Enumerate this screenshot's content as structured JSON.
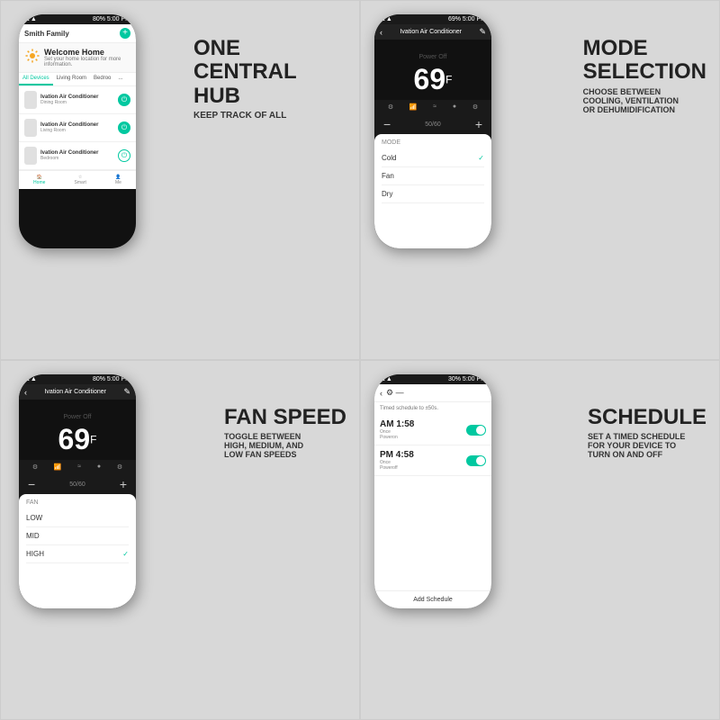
{
  "cells": {
    "cell1": {
      "feature_main": "ONE\nCENTRAL HUB",
      "feature_sub": "KEEP TRACK OF ALL",
      "app": {
        "family": "Smith Family",
        "status_bar": "80%  5:00 PM",
        "welcome_title": "Welcome Home",
        "welcome_sub": "Set your home location for more information.",
        "tabs": [
          "All Devices",
          "Living Room",
          "Bedroo",
          "..."
        ],
        "devices": [
          {
            "name": "Ivation Air Conditioner",
            "room": "Dining Room",
            "on": true
          },
          {
            "name": "Ivation Air Conditioner",
            "room": "Living Room",
            "on": true
          },
          {
            "name": "Ivation Air Conditioner",
            "room": "Bedroom",
            "on": false
          }
        ],
        "nav": [
          "Home",
          "Smart",
          "Me"
        ]
      }
    },
    "cell2": {
      "feature_main": "MODE\nSELECTION",
      "feature_sub": "CHOOSE BETWEEN\nCOOLING, VENTILATION\nOR DEHUMIDIFICATION",
      "app": {
        "status_bar": "69%  5:00 PM",
        "title": "Ivation Air Conditioner",
        "temp": "69",
        "unit": "F",
        "controls": [
          "Home",
          "Fan",
          "Swing",
          "Cool",
          "Settings"
        ],
        "temp_label": "50/60",
        "mode_title": "MODE",
        "modes": [
          {
            "name": "Cold",
            "selected": true
          },
          {
            "name": "Fan",
            "selected": false
          },
          {
            "name": "Dry",
            "selected": false
          }
        ]
      }
    },
    "cell3": {
      "feature_main": "FAN SPEED",
      "feature_sub": "TOGGLE BETWEEN\nHIGH, MEDIUM, AND\nLOW FAN SPEEDS",
      "app": {
        "status_bar": "80%  5:00 PM",
        "title": "Ivation Air Conditioner",
        "temp": "69",
        "unit": "F",
        "temp_label": "50/60",
        "fan_title": "FAN",
        "fan_speeds": [
          {
            "name": "LOW",
            "selected": false
          },
          {
            "name": "MID",
            "selected": false
          },
          {
            "name": "HIGH",
            "selected": true
          }
        ]
      }
    },
    "cell4": {
      "feature_main": "SCHEDULE",
      "feature_sub": "SET A TIMED SCHEDULE\nFOR YOUR DEVICE TO\nTURN ON AND OFF",
      "app": {
        "status_bar": "30%  5:00 PM",
        "subtitle": "Timed schedule to ±50s.",
        "schedules": [
          {
            "time": "AM 1:58",
            "repeat": "Once",
            "action": "Poweron",
            "on": true
          },
          {
            "time": "PM 4:58",
            "repeat": "Once",
            "action": "Poweroff",
            "on": true
          }
        ],
        "add_label": "Add Schedule"
      }
    }
  }
}
